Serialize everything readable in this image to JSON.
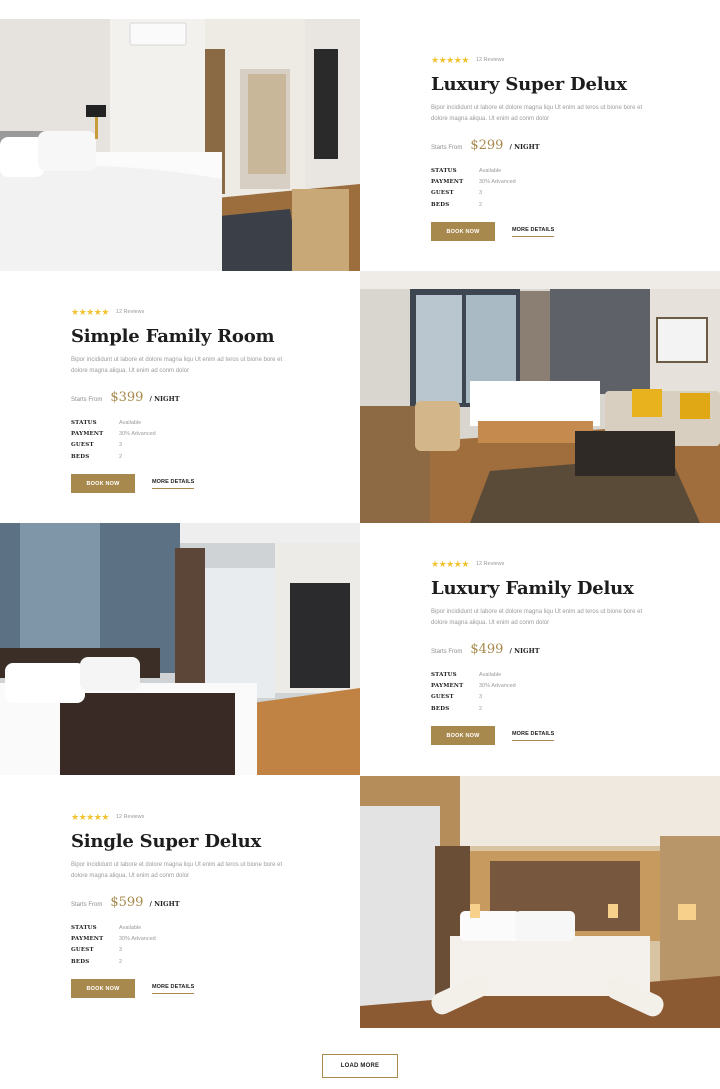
{
  "rooms": [
    {
      "title": "Luxury Super Delux",
      "rating_stars": 5,
      "reviews": "12 Reviews",
      "description": "Bipor incididunt ut labore et dolore magna liqu Ut enim ad teros ut bione bore et dolore magna aliqua. Ut enim ad conm dolor",
      "starts_from": "Starts From",
      "price": "$299",
      "per": "/ NIGHT",
      "specs": [
        {
          "label": "STATUS",
          "value": "Available"
        },
        {
          "label": "PAYMENT",
          "value": "30% Advanced"
        },
        {
          "label": "GUEST",
          "value": "3"
        },
        {
          "label": "BEDS",
          "value": "2"
        }
      ],
      "book_label": "BOOK NOW",
      "more_label": "MORE DETAILS",
      "image": "hotel-room-photo"
    },
    {
      "title": "Simple Family Room",
      "rating_stars": 5,
      "reviews": "12 Reviews",
      "description": "Bipor incididunt ut labore et dolore magna liqu Ut enim ad teros ut bione bore et dolore magna aliqua. Ut enim ad conm dolor",
      "starts_from": "Starts From",
      "price": "$399",
      "per": "/ NIGHT",
      "specs": [
        {
          "label": "STATUS",
          "value": "Available"
        },
        {
          "label": "PAYMENT",
          "value": "30% Advanced"
        },
        {
          "label": "GUEST",
          "value": "3"
        },
        {
          "label": "BEDS",
          "value": "2"
        }
      ],
      "book_label": "BOOK NOW",
      "more_label": "MORE DETAILS",
      "image": "hotel-room-photo"
    },
    {
      "title": "Luxury Family Delux",
      "rating_stars": 5,
      "reviews": "12 Reviews",
      "description": "Bipor incididunt ut labore et dolore magna liqu Ut enim ad teros ut bione bore et dolore magna aliqua. Ut enim ad conm dolor",
      "starts_from": "Starts From",
      "price": "$499",
      "per": "/ NIGHT",
      "specs": [
        {
          "label": "STATUS",
          "value": "Available"
        },
        {
          "label": "PAYMENT",
          "value": "30% Advanced"
        },
        {
          "label": "GUEST",
          "value": "3"
        },
        {
          "label": "BEDS",
          "value": "2"
        }
      ],
      "book_label": "BOOK NOW",
      "more_label": "MORE DETAILS",
      "image": "hotel-room-photo"
    },
    {
      "title": "Single Super Delux",
      "rating_stars": 5,
      "reviews": "12 Reviews",
      "description": "Bipor incididunt ut labore et dolore magna liqu Ut enim ad teros ut bione bore et dolore magna aliqua. Ut enim ad conm dolor",
      "starts_from": "Starts From",
      "price": "$599",
      "per": "/ NIGHT",
      "specs": [
        {
          "label": "STATUS",
          "value": "Available"
        },
        {
          "label": "PAYMENT",
          "value": "30% Advanced"
        },
        {
          "label": "GUEST",
          "value": "3"
        },
        {
          "label": "BEDS",
          "value": "2"
        }
      ],
      "book_label": "BOOK NOW",
      "more_label": "MORE DETAILS",
      "image": "hotel-room-photo"
    }
  ],
  "load_more_label": "LOAD MORE",
  "colors": {
    "accent": "#a8894d",
    "star": "#f2c230",
    "heading": "#1d1d1d",
    "muted": "#9a9a9a"
  }
}
